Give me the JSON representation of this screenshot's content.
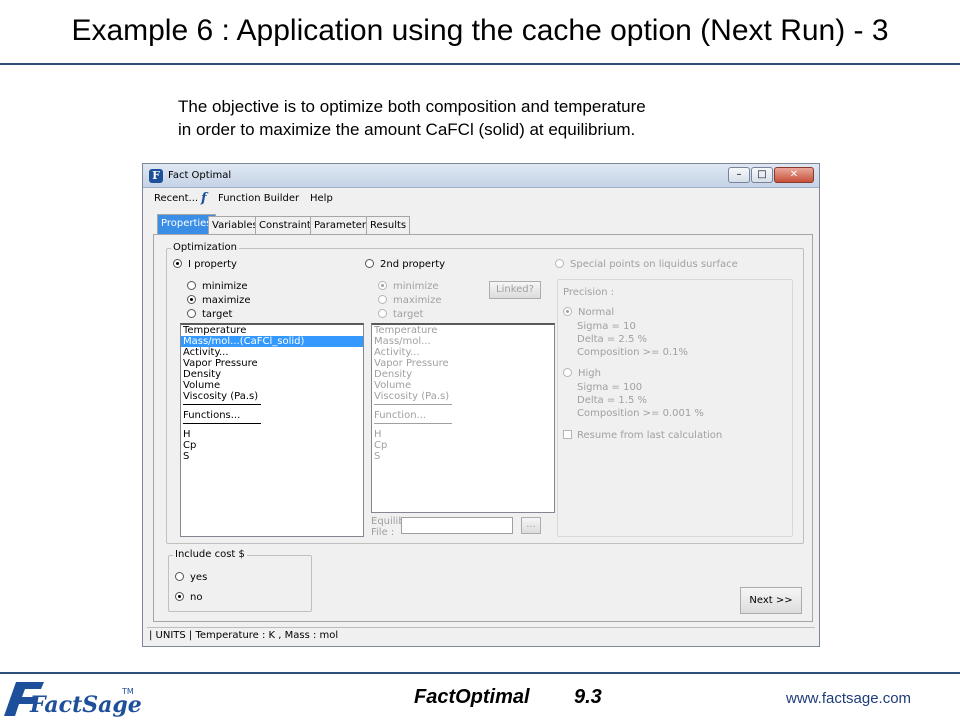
{
  "slide": {
    "title": "Example 6 : Application using the cache option (Next Run) - 3",
    "intro_line1": "The objective is to optimize both composition and temperature",
    "intro_line2": "in order to maximize the amount CaFCl (solid) at equilibrium."
  },
  "window": {
    "title": "Fact Optimal",
    "controls": {
      "minimize": "–",
      "maximize": "□",
      "close": "✕"
    },
    "menu": {
      "recent": "Recent...",
      "function_builder": "Function Builder",
      "help": "Help"
    },
    "tabs": [
      "Properties",
      "Variables",
      "Constraints",
      "Parameters",
      "Results"
    ],
    "active_tab": "Properties",
    "optimization": {
      "legend": "Optimization",
      "prop_options": [
        {
          "label": "I property",
          "selected": true,
          "enabled": true
        },
        {
          "label": "2nd property",
          "selected": false,
          "enabled": true
        },
        {
          "label": "Special points on liquidus surface",
          "selected": false,
          "enabled": false
        }
      ],
      "first": {
        "mode_options": [
          {
            "label": "minimize",
            "selected": false
          },
          {
            "label": "maximize",
            "selected": true
          },
          {
            "label": "target",
            "selected": false
          }
        ],
        "list": [
          "Temperature",
          "Mass/mol...(CaFCl_solid)",
          "Activity...",
          "Vapor Pressure",
          "Density",
          "Volume",
          "Viscosity (Pa.s)",
          "---",
          "Functions...",
          "---",
          "H",
          "Cp",
          "S"
        ],
        "selected_item": "Mass/mol...(CaFCl_solid)"
      },
      "second": {
        "mode_options": [
          {
            "label": "minimize",
            "selected": true
          },
          {
            "label": "maximize",
            "selected": false
          },
          {
            "label": "target",
            "selected": false
          }
        ],
        "linked_button": "Linked?",
        "list": [
          "Temperature",
          "Mass/mol...",
          "Activity...",
          "Vapor Pressure",
          "Density",
          "Volume",
          "Viscosity (Pa.s)",
          "---",
          "Function...",
          "---",
          "H",
          "Cp",
          "S"
        ],
        "equilib_label_1": "Equilib",
        "equilib_label_2": "File :",
        "equilib_value": "",
        "browse_button": "..."
      },
      "precision": {
        "label": "Precision :",
        "normal": {
          "label": "Normal",
          "selected": true,
          "sigma": "Sigma = 10",
          "delta": "Delta = 2.5 %",
          "composition": "Composition >= 0.1%"
        },
        "high": {
          "label": "High",
          "selected": false,
          "sigma": "Sigma = 100",
          "delta": "Delta = 1.5 %",
          "composition": "Composition >= 0.001 %"
        },
        "resume": "Resume from last calculation"
      }
    },
    "cost": {
      "legend": "Include cost $",
      "options": [
        {
          "label": "yes",
          "selected": false
        },
        {
          "label": "no",
          "selected": true
        }
      ]
    },
    "next_button": "Next >>",
    "status": "| UNITS | Temperature : K , Mass : mol"
  },
  "footer": {
    "app_name": "FactOptimal",
    "version": "9.3",
    "url": "www.factsage.com",
    "logo_text": "FactSage",
    "logo_tm": "TM"
  }
}
